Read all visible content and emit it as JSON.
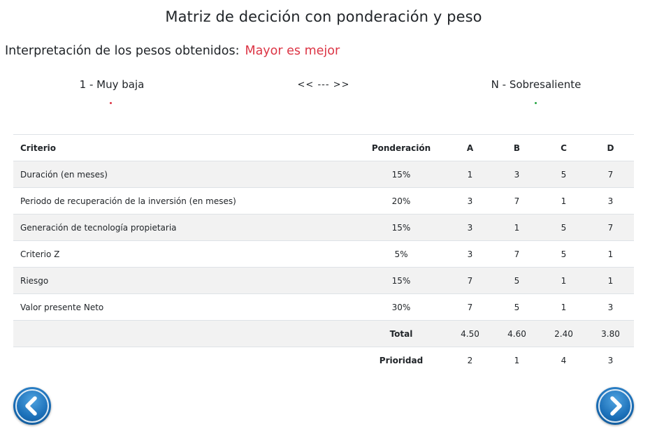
{
  "page": {
    "title": "Matriz de decición con ponderación y peso"
  },
  "interpretation": {
    "label": "Interpretación de los pesos obtenidos:",
    "value": "Mayor es mejor",
    "value_color": "#dc3545"
  },
  "scale": {
    "low": "1 - Muy baja",
    "middle": "<< --- >>",
    "high": "N - Sobresaliente",
    "low_dot_color": "#dc3545",
    "high_dot_color": "#28a745"
  },
  "table": {
    "headers": {
      "criterio": "Criterio",
      "ponderacion": "Ponderación",
      "options": [
        "A",
        "B",
        "C",
        "D"
      ]
    },
    "rows": [
      {
        "criterio": "Duración (en meses)",
        "ponderacion": "15%",
        "values": [
          "1",
          "3",
          "5",
          "7"
        ]
      },
      {
        "criterio": "Periodo de recuperación de la inversión (en meses)",
        "ponderacion": "20%",
        "values": [
          "3",
          "7",
          "1",
          "3"
        ]
      },
      {
        "criterio": "Generación de tecnología propietaria",
        "ponderacion": "15%",
        "values": [
          "3",
          "1",
          "5",
          "7"
        ]
      },
      {
        "criterio": "Criterio Z",
        "ponderacion": "5%",
        "values": [
          "3",
          "7",
          "5",
          "1"
        ]
      },
      {
        "criterio": "Riesgo",
        "ponderacion": "15%",
        "values": [
          "7",
          "5",
          "1",
          "1"
        ]
      },
      {
        "criterio": "Valor presente Neto",
        "ponderacion": "30%",
        "values": [
          "7",
          "5",
          "1",
          "3"
        ]
      }
    ],
    "total": {
      "label": "Total",
      "values": [
        "4.50",
        "4.60",
        "2.40",
        "3.80"
      ]
    },
    "priority": {
      "label": "Prioridad",
      "values": [
        "2",
        "1",
        "4",
        "3"
      ]
    }
  },
  "navigation": {
    "prev_icon": "chevron-left-icon",
    "next_icon": "chevron-right-icon",
    "button_color": "#1b6fb8"
  }
}
